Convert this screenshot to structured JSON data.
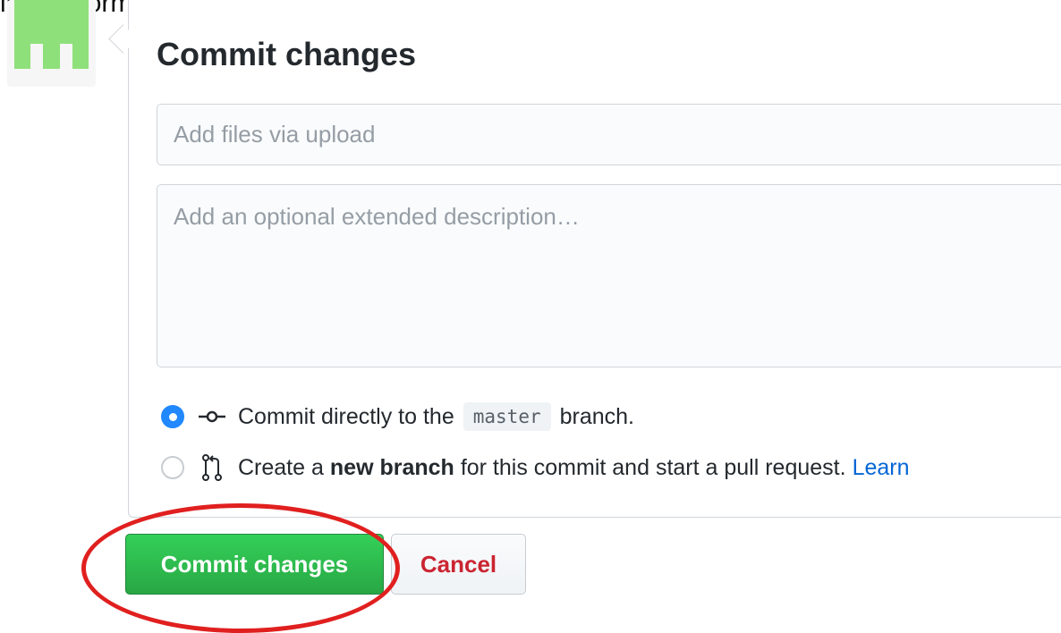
{
  "page": {
    "top_caption": "lingan formulario:"
  },
  "commit_form": {
    "title": "Commit changes",
    "summary_placeholder": "Add files via upload",
    "description_placeholder": "Add an optional extended description…",
    "option_direct": {
      "selected": true,
      "prefix": "Commit directly to the",
      "branch": "master",
      "suffix": "branch."
    },
    "option_new_branch": {
      "selected": false,
      "prefix": "Create a",
      "bold": "new branch",
      "suffix": "for this commit and start a pull request.",
      "link": "Learn"
    },
    "buttons": {
      "commit_label": "Commit changes",
      "cancel_label": "Cancel"
    }
  },
  "colors": {
    "primary_green": "#28a745",
    "cancel_red": "#cb2431",
    "radio_blue": "#2188ff",
    "link_blue": "#0366d6",
    "annotation_red": "#e0201f",
    "avatar_green": "#8ee07a"
  },
  "icons": {
    "commit": "git-commit-icon",
    "pull_request": "git-pull-request-icon",
    "avatar": "identicon-avatar"
  }
}
